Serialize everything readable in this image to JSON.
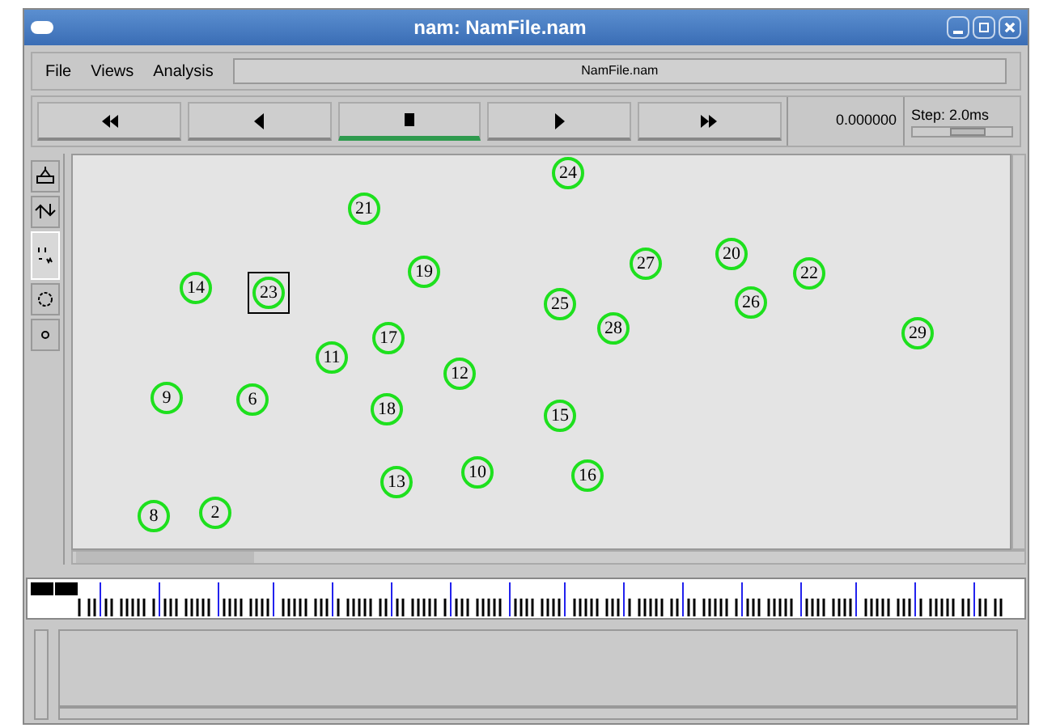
{
  "window": {
    "title": "nam: NamFile.nam"
  },
  "menu": [
    "File",
    "Views",
    "Analysis"
  ],
  "file_label": "NamFile.nam",
  "transport": [
    {
      "kind": "rewind",
      "selected": false
    },
    {
      "kind": "back",
      "selected": false
    },
    {
      "kind": "stop",
      "selected": true
    },
    {
      "kind": "play",
      "selected": false
    },
    {
      "kind": "forward",
      "selected": false
    }
  ],
  "time": "0.000000",
  "step": {
    "label": "Step: 2.0ms",
    "level": 0.55
  },
  "tools": [
    {
      "kind": "zoom-in",
      "selected": false
    },
    {
      "kind": "zoom-out",
      "selected": false
    },
    {
      "kind": "view",
      "selected": true
    },
    {
      "kind": "circle",
      "selected": false
    },
    {
      "kind": "dot",
      "selected": false
    }
  ],
  "nodes": [
    {
      "label": "24",
      "selected": false
    },
    {
      "label": "21",
      "selected": false
    },
    {
      "label": "19",
      "selected": false
    },
    {
      "label": "27",
      "selected": false
    },
    {
      "label": "20",
      "selected": false
    },
    {
      "label": "22",
      "selected": false
    },
    {
      "label": "14",
      "selected": false
    },
    {
      "label": "23",
      "selected": true
    },
    {
      "label": "25",
      "selected": false
    },
    {
      "label": "26",
      "selected": false
    },
    {
      "label": "17",
      "selected": false
    },
    {
      "label": "28",
      "selected": false
    },
    {
      "label": "29",
      "selected": false
    },
    {
      "label": "11",
      "selected": false
    },
    {
      "label": "12",
      "selected": false
    },
    {
      "label": "9",
      "selected": false
    },
    {
      "label": "6",
      "selected": false
    },
    {
      "label": "18",
      "selected": false
    },
    {
      "label": "15",
      "selected": false
    },
    {
      "label": "13",
      "selected": false
    },
    {
      "label": "10",
      "selected": false
    },
    {
      "label": "16",
      "selected": false
    },
    {
      "label": "8",
      "selected": false
    },
    {
      "label": "2",
      "selected": false
    }
  ]
}
